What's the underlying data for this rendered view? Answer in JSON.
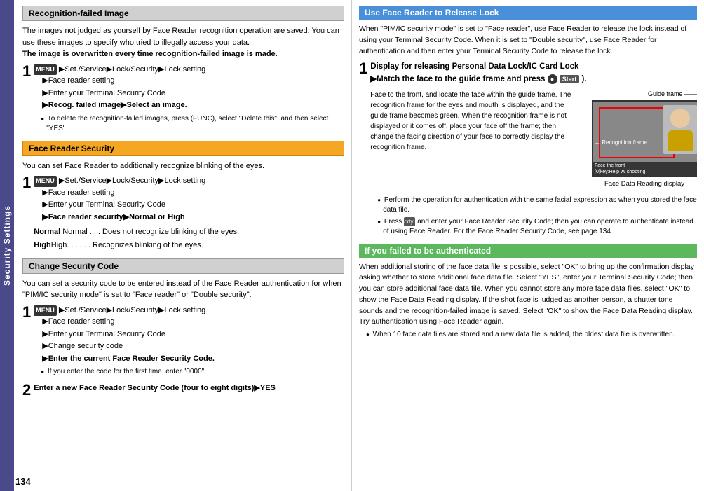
{
  "page": {
    "number": "134",
    "sidebar_label": "Security Settings"
  },
  "left": {
    "section1": {
      "header": "Recognition-failed Image",
      "body": "The images not judged as yourself by Face Reader recognition operation are saved. You can use these images to specify who tried to illegally access your data.",
      "bold_line": "The image is overwritten every time recognition-failed image is made.",
      "step1": {
        "num": "1",
        "menu_key": "MENU",
        "path": "▶Set./Service▶Lock/Security▶Lock setting",
        "items": [
          "▶Face reader setting",
          "▶Enter your Terminal Security Code",
          "▶Recog. failed image▶Select an image."
        ],
        "note": "To delete the recognition-failed images, press (FUNC), select \"Delete this\", and then select \"YES\"."
      }
    },
    "section2": {
      "header": "Face Reader Security",
      "body": "You can set Face Reader to additionally recognize blinking of the eyes.",
      "step1": {
        "num": "1",
        "menu_key": "MENU",
        "path": "▶Set./Service▶Lock/Security▶Lock setting",
        "items": [
          "▶Face reader setting",
          "▶Enter your Terminal Security Code",
          "▶Face reader security▶Normal or High"
        ],
        "normal_desc": "Normal . . . Does not recognize blinking of the eyes.",
        "high_desc": "High. . . . . . Recognizes blinking of the eyes."
      }
    },
    "section3": {
      "header": "Change Security Code",
      "body1": "You can set a security code to be entered instead of the Face Reader authentication for when \"PIM/IC security mode\" is set to \"Face reader\" or \"Double security\".",
      "step1": {
        "num": "1",
        "menu_key": "MENU",
        "path": "▶Set./Service▶Lock/Security▶Lock setting",
        "items": [
          "▶Face reader setting",
          "▶Enter your Terminal Security Code",
          "▶Change security code",
          "▶Enter the current Face Reader Security Code."
        ],
        "note": "If you enter the code for the first time, enter \"0000\"."
      },
      "step2": {
        "num": "2",
        "text": "Enter a new Face Reader Security Code (four to eight digits)▶YES"
      }
    }
  },
  "right": {
    "section1": {
      "header": "Use Face Reader to Release Lock",
      "body": "When \"PIM/IC security mode\" is set to \"Face reader\", use Face Reader to release the lock instead of using your Terminal Security Code. When it is set to \"Double security\", use Face Reader for authentication and then enter your Terminal Security Code to release the lock.",
      "step1": {
        "num": "1",
        "text1": "Display for releasing Personal Data Lock/IC Card Lock",
        "text2": "▶Match the face to the guide frame and press",
        "start_symbol": "●",
        "start_label": "Start",
        "text3": ").",
        "face_description": "Face to the front, and locate the face within the guide frame. The recognition frame for the eyes and mouth is displayed, and the guide frame becomes green. When the recognition frame is not displayed or it comes off, place your face off the frame; then change the facing direction of your face to correctly display the recognition frame.",
        "guide_label": "Guide frame",
        "recog_label": "Recognition frame",
        "frame_text1": "Face the front",
        "frame_text2": "[0]key:Help w/ shooting",
        "caption": "Face Data Reading display",
        "note1": "Perform the operation for authentication with the same facial expression as when you stored the face data file.",
        "note2": "Press (Scrty) and enter your Face Reader Security Code; then you can operate to authenticate instead of using Face Reader. For the Face Reader Security Code, see page 134."
      }
    },
    "section2": {
      "header": "If you failed to be authenticated",
      "body": "When additional storing of the face data file is possible, select \"OK\" to bring up the confirmation display asking whether to store additional face data file. Select \"YES\", enter your Terminal Security Code; then you can store additional face data file. When you cannot store any more face data files, select \"OK\" to show the Face Data Reading display. If the shot face is judged as another person, a shutter tone sounds and the recognition-failed image is saved. Select \"OK\" to show the Face Data Reading display. Try authentication using Face Reader again.",
      "note1": "When 10 face data files are stored and a new data file is added, the oldest data file is overwritten."
    }
  }
}
